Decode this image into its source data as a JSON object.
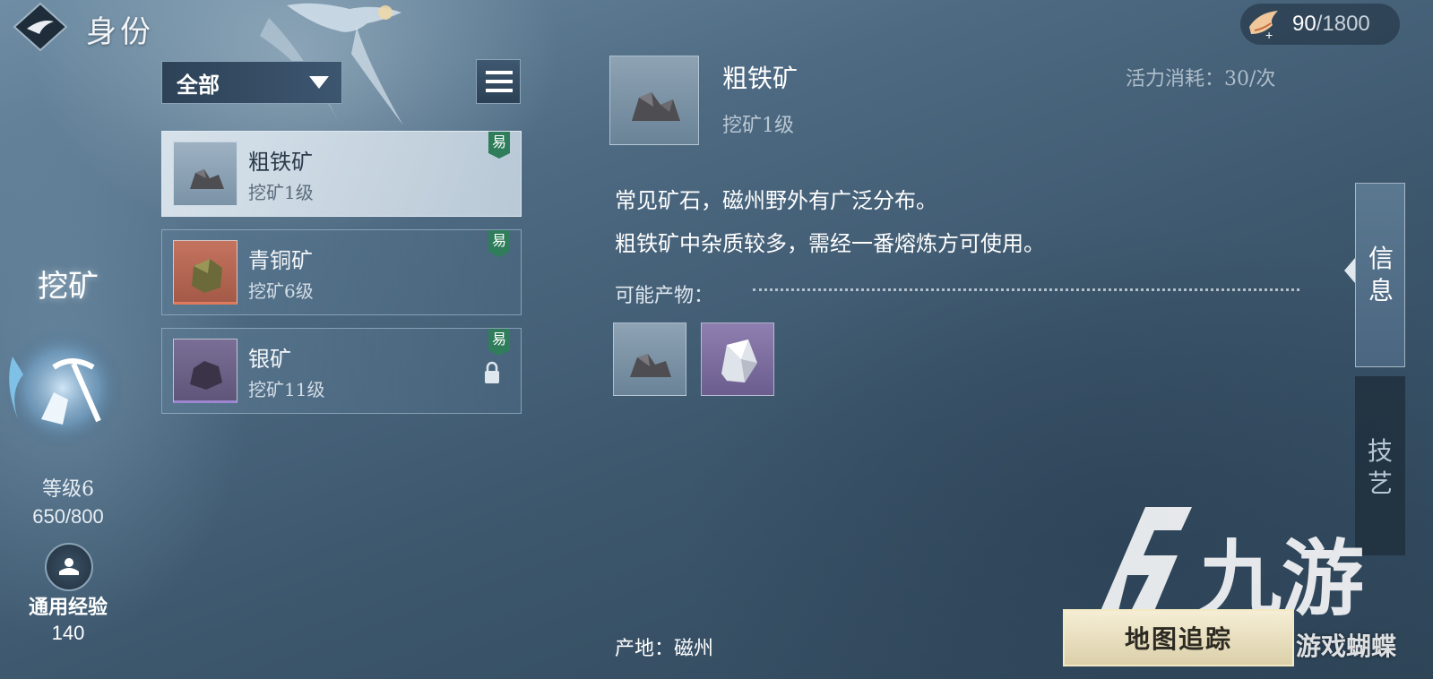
{
  "header": {
    "title": "身份",
    "back_icon": "diamond-back-icon"
  },
  "stamina": {
    "icon": "bird-stamina-icon",
    "current": "90",
    "max": "/1800"
  },
  "skill": {
    "name": "挖矿",
    "emblem_icon": "pickaxe-emblem-icon",
    "level": "等级6",
    "progress": "650/800",
    "exp_label": "通用经验",
    "exp_value": "140"
  },
  "filter": {
    "selected": "全部"
  },
  "items": [
    {
      "name": "粗铁矿",
      "requirement": "挖矿1级",
      "badge": "易",
      "selected": true,
      "locked": false,
      "color": "#5a5a5e"
    },
    {
      "name": "青铜矿",
      "requirement": "挖矿6级",
      "badge": "易",
      "selected": false,
      "locked": false,
      "color": "#6c6a3a"
    },
    {
      "name": "银矿",
      "requirement": "挖矿11级",
      "badge": "易",
      "selected": false,
      "locked": true,
      "color": "#3b3448"
    }
  ],
  "detail": {
    "name": "粗铁矿",
    "requirement": "挖矿1级",
    "cost": "活力消耗：30/次",
    "desc_line1": "常见矿石，磁州野外有广泛分布。",
    "desc_line2": "粗铁矿中杂质较多，需经一番熔炼方可使用。",
    "products_label": "可能产物：",
    "products": [
      "iron-ore-icon",
      "silver-crystal-icon"
    ],
    "origin": "产地：磁州"
  },
  "tabs": [
    {
      "label": "信息",
      "active": true
    },
    {
      "label": "技艺",
      "active": false
    }
  ],
  "map_button": "地图追踪",
  "watermark": {
    "logo_text": "九游",
    "site_text": "游戏蝴蝶"
  }
}
